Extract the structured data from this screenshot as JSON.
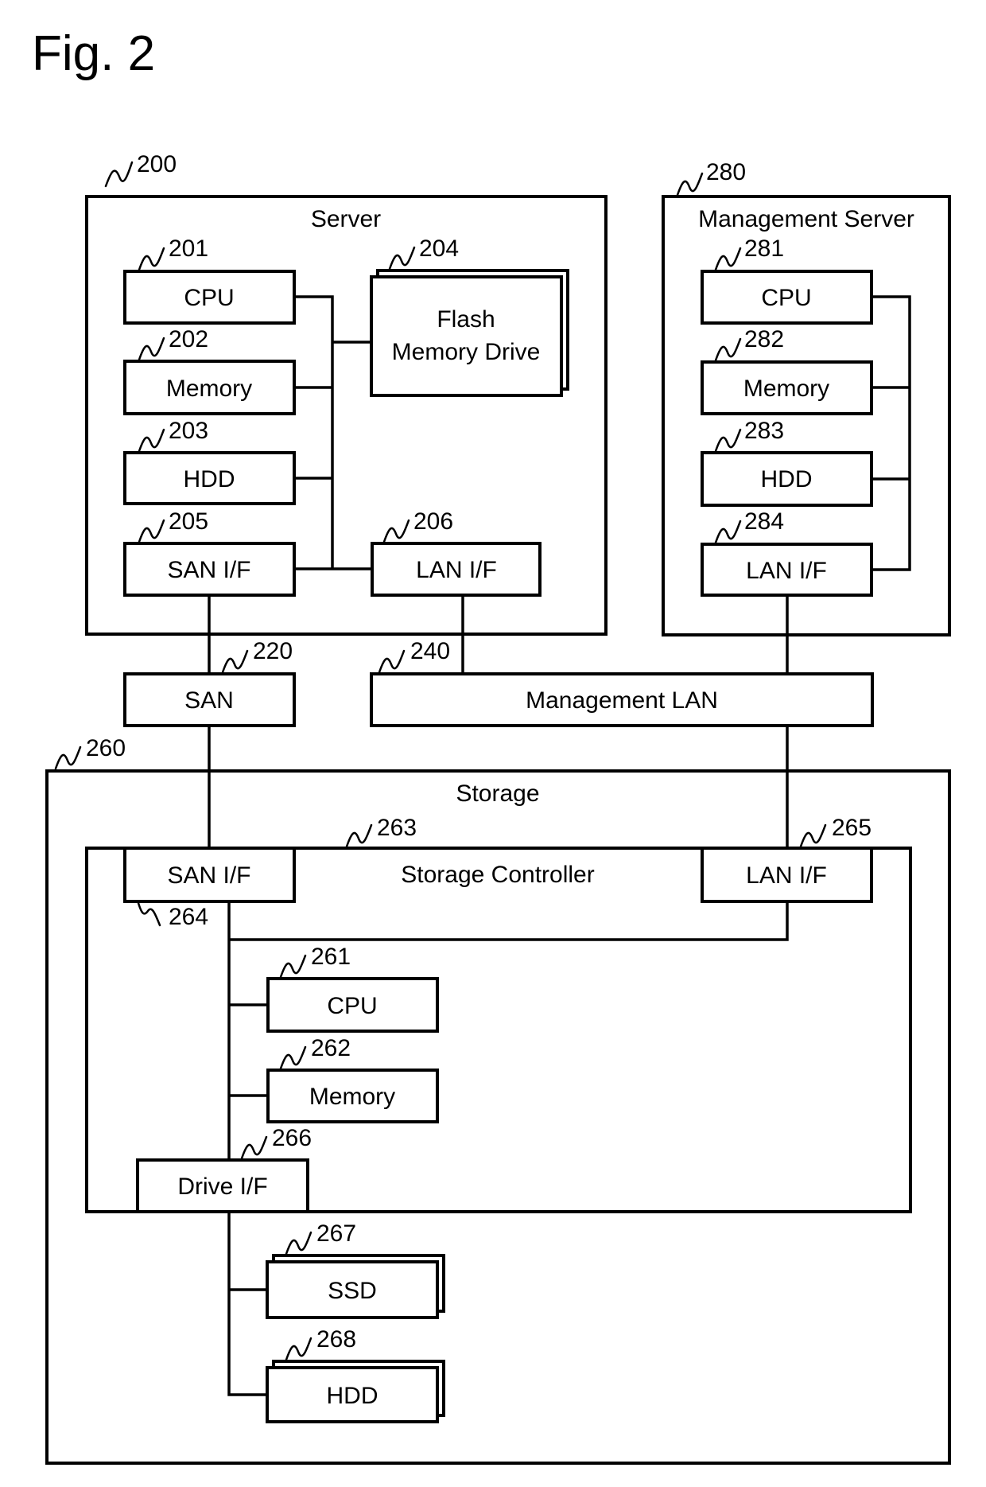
{
  "figure": {
    "title": "Fig. 2"
  },
  "server": {
    "ref": "200",
    "label": "Server",
    "cpu": {
      "ref": "201",
      "label": "CPU"
    },
    "memory": {
      "ref": "202",
      "label": "Memory"
    },
    "hdd": {
      "ref": "203",
      "label": "HDD"
    },
    "flash": {
      "ref": "204",
      "label_line1": "Flash",
      "label_line2": "Memory Drive"
    },
    "san_if": {
      "ref": "205",
      "label": "SAN I/F"
    },
    "lan_if": {
      "ref": "206",
      "label": "LAN I/F"
    }
  },
  "san": {
    "ref": "220",
    "label": "SAN"
  },
  "management_lan": {
    "ref": "240",
    "label": "Management LAN"
  },
  "storage": {
    "ref": "260",
    "label": "Storage",
    "controller": {
      "ref": "263",
      "label": "Storage Controller"
    },
    "san_if": {
      "ref": "264",
      "label": "SAN I/F"
    },
    "lan_if": {
      "ref": "265",
      "label": "LAN I/F"
    },
    "cpu": {
      "ref": "261",
      "label": "CPU"
    },
    "memory": {
      "ref": "262",
      "label": "Memory"
    },
    "drive_if": {
      "ref": "266",
      "label": "Drive I/F"
    },
    "ssd": {
      "ref": "267",
      "label": "SSD"
    },
    "hdd": {
      "ref": "268",
      "label": "HDD"
    }
  },
  "management_server": {
    "ref": "280",
    "label": "Management Server",
    "cpu": {
      "ref": "281",
      "label": "CPU"
    },
    "memory": {
      "ref": "282",
      "label": "Memory"
    },
    "hdd": {
      "ref": "283",
      "label": "HDD"
    },
    "lan_if": {
      "ref": "284",
      "label": "LAN I/F"
    }
  }
}
